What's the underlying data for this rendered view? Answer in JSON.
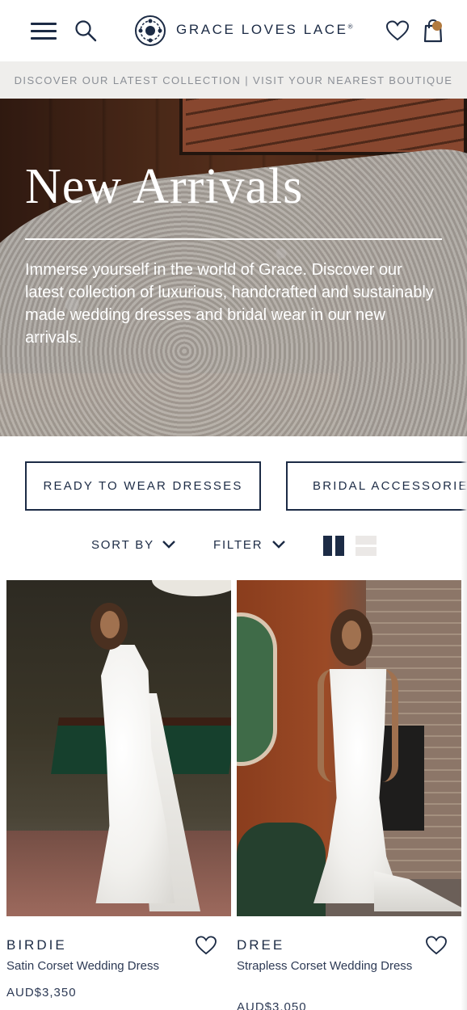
{
  "header": {
    "brand": "GRACE LOVES LACE",
    "brand_mark": "®",
    "icons": [
      "menu-icon",
      "search-icon",
      "heart-icon",
      "bag-icon"
    ]
  },
  "announcement": {
    "text": "DISCOVER OUR LATEST COLLECTION | VISIT YOUR NEAREST BOUTIQUE"
  },
  "hero": {
    "title": "New Arrivals",
    "description": "Immerse yourself in the world of Grace. Discover our latest collection of luxurious, handcrafted and sustainably made wedding dresses and bridal wear in our new arrivals."
  },
  "categories": [
    {
      "label": "READY TO WEAR DRESSES"
    },
    {
      "label": "BRIDAL ACCESSORIES"
    }
  ],
  "toolbar": {
    "sort_label": "SORT BY",
    "filter_label": "FILTER"
  },
  "products": [
    {
      "name": "BIRDIE",
      "description": "Satin Corset Wedding Dress",
      "price": "AUD$3,350"
    },
    {
      "name": "DREE",
      "description": "Strapless Corset Wedding Dress",
      "price": "AUD$3,050"
    }
  ],
  "colors": {
    "navy": "#1c2b45",
    "announcement_bg": "#efeeec",
    "cart_badge": "#b27a3e"
  }
}
